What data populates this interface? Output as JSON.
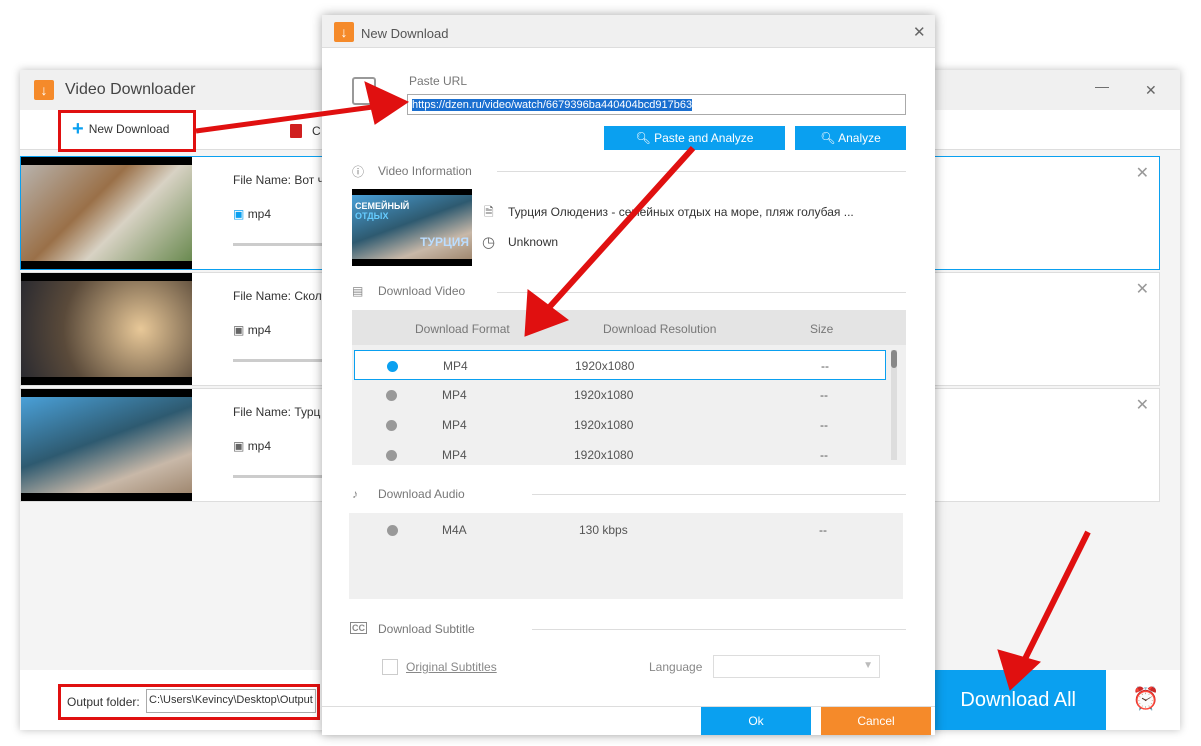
{
  "main_window": {
    "title": "Video Downloader",
    "toolbar": {
      "new_download": "New Download",
      "clear_partial": "C"
    },
    "items": [
      {
        "file_name": "File Name: Вот ч",
        "format": "mp4"
      },
      {
        "file_name": "File Name: Сколь",
        "format": "mp4"
      },
      {
        "file_name": "File Name: Турц",
        "format": "mp4"
      }
    ],
    "output_label": "Output folder:",
    "output_path": "C:\\Users\\Kevincy\\Desktop\\Output",
    "download_all": "Download All",
    "controls": {
      "minimize": "—",
      "close": "✕"
    }
  },
  "dialog": {
    "title": "New Download",
    "paste_url_label": "Paste URL",
    "url": "https://dzen.ru/video/watch/6679396ba440404bcd917b63",
    "paste_analyze": "Paste and Analyze",
    "analyze": "Analyze",
    "video_info_label": "Video Information",
    "video_title": "Турция Олюдениз - семейных отдых на море, пляж голубая ...",
    "duration": "Unknown",
    "thumb_text": [
      "СЕМЕЙНЫЙ",
      "ОТДЫХ",
      "ТУРЦИЯ"
    ],
    "download_video_label": "Download Video",
    "video_headers": [
      "Download Format",
      "Download Resolution",
      "Size"
    ],
    "video_rows": [
      {
        "format": "MP4",
        "resolution": "1920x1080",
        "size": "--",
        "selected": true
      },
      {
        "format": "MP4",
        "resolution": "1920x1080",
        "size": "--",
        "selected": false
      },
      {
        "format": "MP4",
        "resolution": "1920x1080",
        "size": "--",
        "selected": false
      },
      {
        "format": "MP4",
        "resolution": "1920x1080",
        "size": "--",
        "selected": false
      }
    ],
    "download_audio_label": "Download Audio",
    "audio_rows": [
      {
        "format": "M4A",
        "bitrate": "130 kbps",
        "size": "--"
      }
    ],
    "download_subtitle_label": "Download Subtitle",
    "original_subtitles": "Original Subtitles",
    "language_label": "Language",
    "ok": "Ok",
    "cancel": "Cancel"
  },
  "colors": {
    "accent": "#0aa0f0",
    "cancel": "#f58a2a",
    "annotation": "#e01010"
  }
}
